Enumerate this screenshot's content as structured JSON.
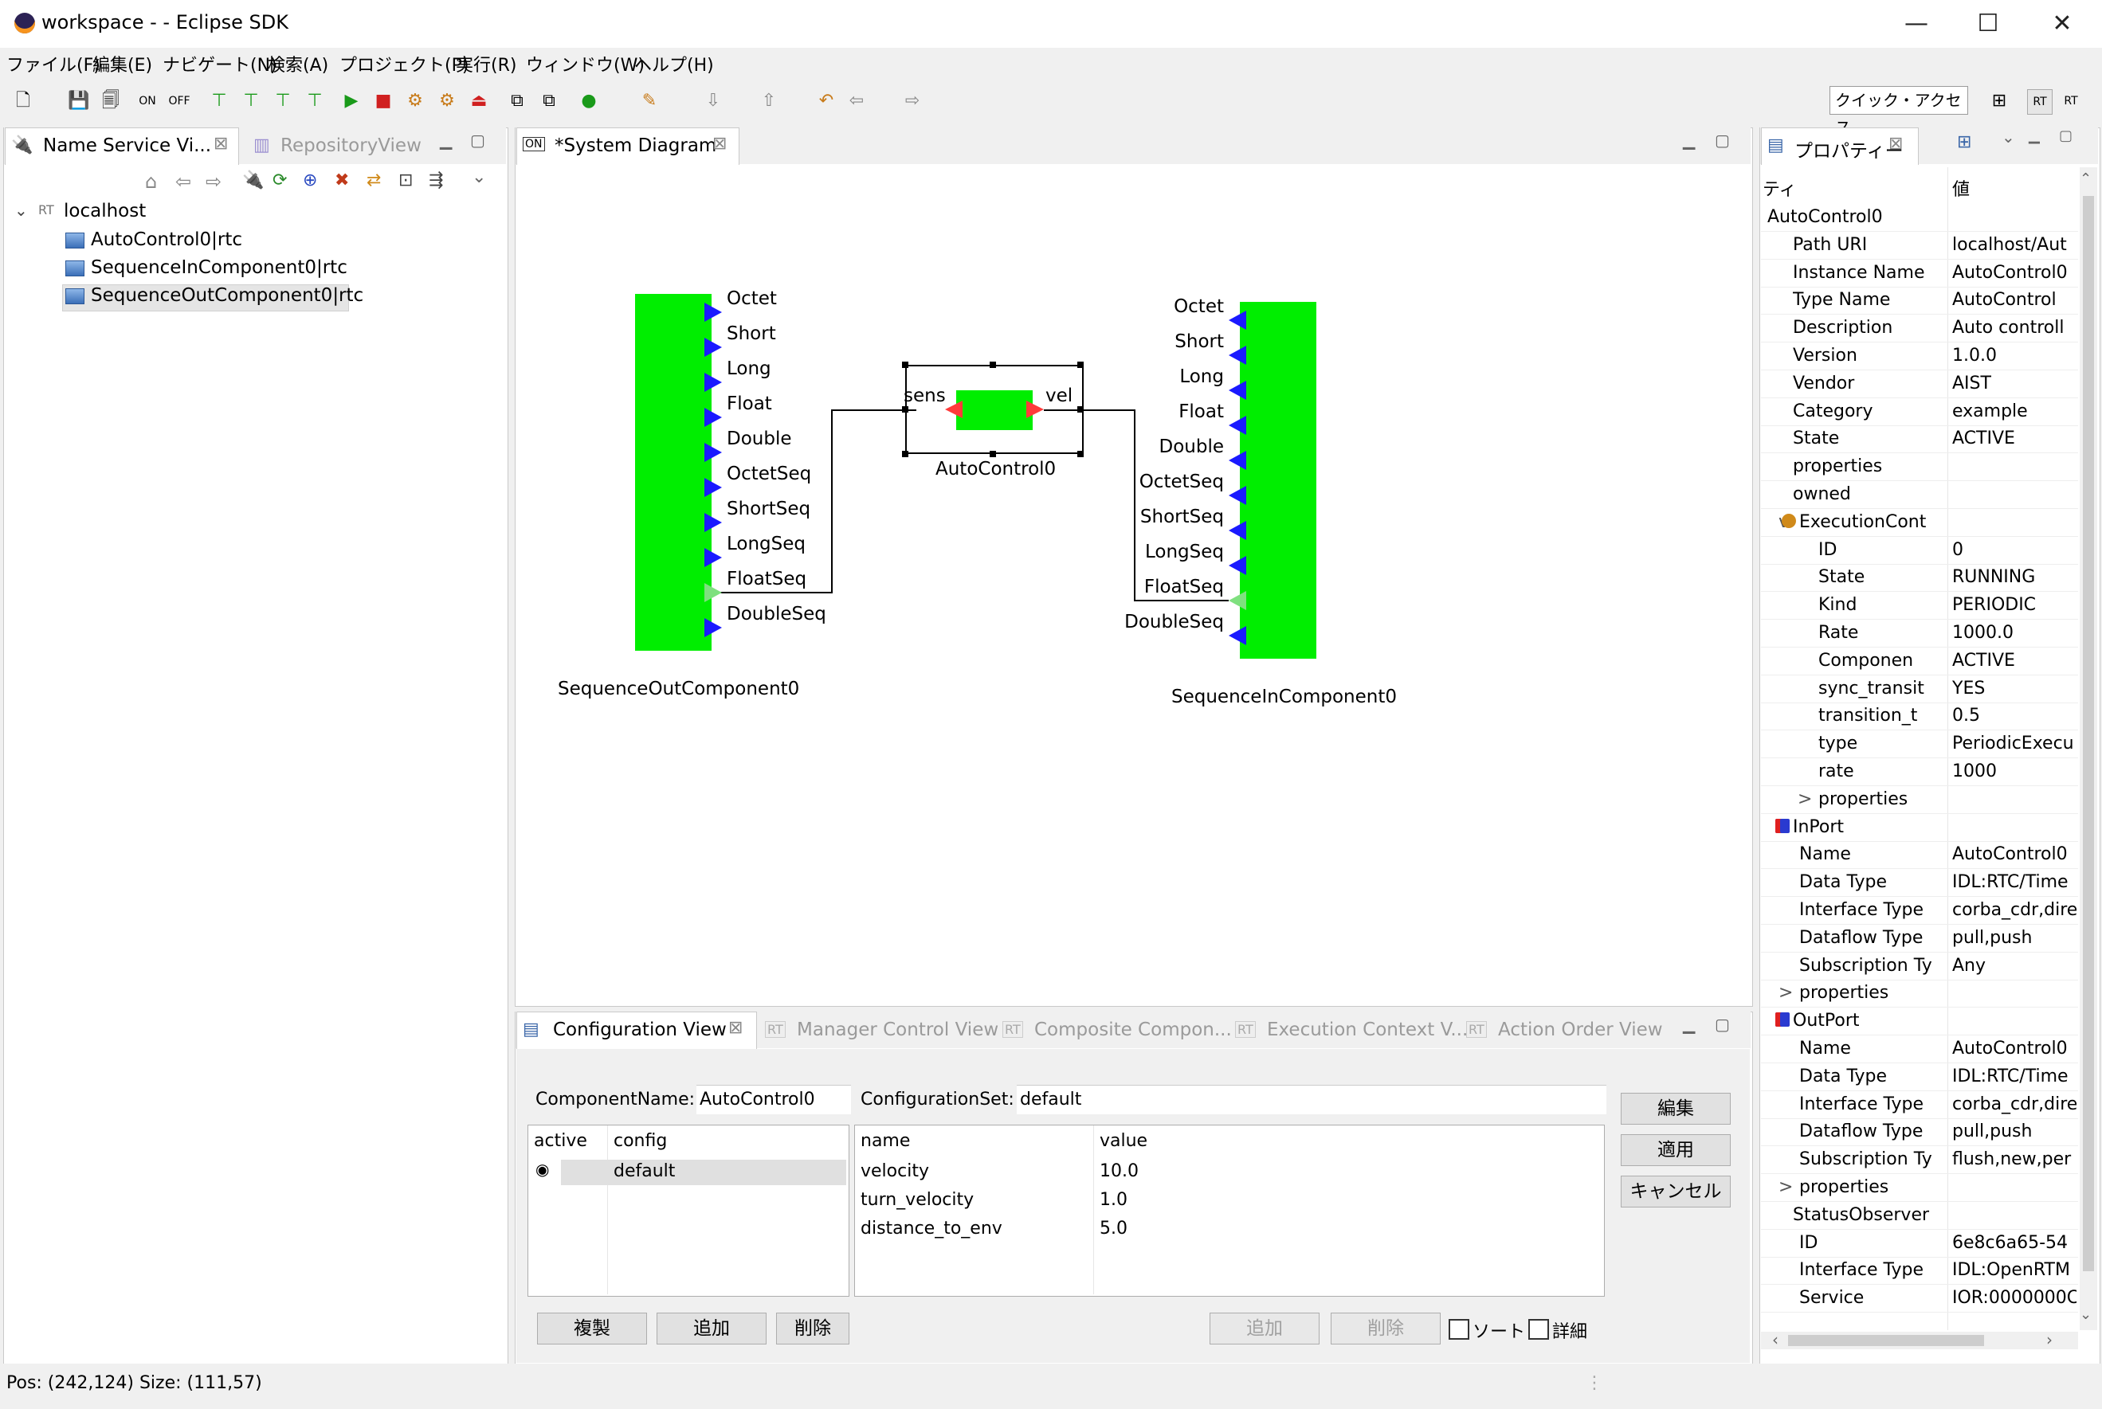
{
  "window": {
    "title": "workspace -  - Eclipse SDK",
    "minimize": "—",
    "maximize": "☐",
    "close": "✕"
  },
  "menu": [
    "ファイル(F)",
    "編集(E)",
    "ナビゲート(N)",
    "検索(A)",
    "プロジェクト(P)",
    "実行(R)",
    "ウィンドウ(W)",
    "ヘルプ(H)"
  ],
  "quick_access": "クイック・アクセス",
  "left_panel": {
    "tabs": [
      {
        "label": "Name Service Vi..."
      },
      {
        "label": "RepositoryView"
      }
    ],
    "tree": {
      "root": "localhost",
      "items": [
        "AutoControl0|rtc",
        "SequenceInComponent0|rtc",
        "SequenceOutComponent0|rtc"
      ]
    }
  },
  "editor": {
    "tab": "*System Diagram",
    "out_component": {
      "name": "SequenceOutComponent0",
      "ports": [
        "Octet",
        "Short",
        "Long",
        "Float",
        "Double",
        "OctetSeq",
        "ShortSeq",
        "LongSeq",
        "FloatSeq",
        "DoubleSeq"
      ]
    },
    "in_component": {
      "name": "SequenceInComponent0",
      "ports": [
        "Octet",
        "Short",
        "Long",
        "Float",
        "Double",
        "OctetSeq",
        "ShortSeq",
        "LongSeq",
        "FloatSeq",
        "DoubleSeq"
      ]
    },
    "auto_component": {
      "name": "AutoControl0",
      "in_port": "sens",
      "out_port": "vel"
    }
  },
  "bottom_panel": {
    "tabs": [
      "Configuration View",
      "Manager Control View",
      "Composite Compon...",
      "Execution Context V...",
      "Action Order View"
    ],
    "component_name_label": "ComponentName:",
    "component_name": "AutoControl0",
    "configuration_set_label": "ConfigurationSet:",
    "configuration_set": "default",
    "set_table": {
      "headers": [
        "active",
        "config"
      ],
      "rows": [
        {
          "active": "◉",
          "config": "default"
        }
      ]
    },
    "param_table": {
      "headers": [
        "name",
        "value"
      ],
      "rows": [
        {
          "name": "velocity",
          "value": "10.0"
        },
        {
          "name": "turn_velocity",
          "value": "1.0"
        },
        {
          "name": "distance_to_env",
          "value": "5.0"
        }
      ]
    },
    "buttons": {
      "edit": "編集",
      "apply": "適用",
      "cancel": "キャンセル",
      "copy": "複製",
      "add": "追加",
      "delete": "削除",
      "add2": "追加",
      "delete2": "削除",
      "sort": "ソート",
      "detail": "詳細"
    }
  },
  "properties": {
    "tab": "プロパティー",
    "headers": [
      "ティ",
      "値"
    ],
    "rows": [
      {
        "indent": 0,
        "key": "AutoControl0",
        "value": ""
      },
      {
        "indent": 1,
        "key": "Path URI",
        "value": "localhost/Aut"
      },
      {
        "indent": 1,
        "key": "Instance Name",
        "value": "AutoControl0"
      },
      {
        "indent": 1,
        "key": "Type Name",
        "value": "AutoControl"
      },
      {
        "indent": 1,
        "key": "Description",
        "value": "Auto controll"
      },
      {
        "indent": 1,
        "key": "Version",
        "value": "1.0.0"
      },
      {
        "indent": 1,
        "key": "Vendor",
        "value": "AIST"
      },
      {
        "indent": 1,
        "key": "Category",
        "value": "example"
      },
      {
        "indent": 1,
        "key": "State",
        "value": "ACTIVE"
      },
      {
        "indent": 1,
        "key": "properties",
        "value": ""
      },
      {
        "indent": 1,
        "key": "owned",
        "value": ""
      },
      {
        "indent": 2,
        "key": "ExecutionCont",
        "value": "",
        "expand": "v",
        "icon": "gear"
      },
      {
        "indent": 3,
        "key": "ID",
        "value": "0"
      },
      {
        "indent": 3,
        "key": "State",
        "value": "RUNNING"
      },
      {
        "indent": 3,
        "key": "Kind",
        "value": "PERIODIC"
      },
      {
        "indent": 3,
        "key": "Rate",
        "value": "1000.0"
      },
      {
        "indent": 3,
        "key": "Componen",
        "value": "ACTIVE"
      },
      {
        "indent": 3,
        "key": "sync_transit",
        "value": "YES"
      },
      {
        "indent": 3,
        "key": "transition_t",
        "value": "0.5"
      },
      {
        "indent": 3,
        "key": "type",
        "value": "PeriodicExecu"
      },
      {
        "indent": 3,
        "key": "rate",
        "value": "1000"
      },
      {
        "indent": 3,
        "key": "properties",
        "value": "",
        "expand": ">"
      },
      {
        "indent": 1,
        "key": "InPort",
        "value": "",
        "icon": "in"
      },
      {
        "indent": 2,
        "key": "Name",
        "value": "AutoControl0"
      },
      {
        "indent": 2,
        "key": "Data Type",
        "value": "IDL:RTC/Time"
      },
      {
        "indent": 2,
        "key": "Interface Type",
        "value": "corba_cdr,dire"
      },
      {
        "indent": 2,
        "key": "Dataflow Type",
        "value": "pull,push"
      },
      {
        "indent": 2,
        "key": "Subscription Ty",
        "value": "Any"
      },
      {
        "indent": 2,
        "key": "properties",
        "value": "",
        "expand": ">"
      },
      {
        "indent": 1,
        "key": "OutPort",
        "value": "",
        "icon": "out"
      },
      {
        "indent": 2,
        "key": "Name",
        "value": "AutoControl0"
      },
      {
        "indent": 2,
        "key": "Data Type",
        "value": "IDL:RTC/Time"
      },
      {
        "indent": 2,
        "key": "Interface Type",
        "value": "corba_cdr,dire"
      },
      {
        "indent": 2,
        "key": "Dataflow Type",
        "value": "pull,push"
      },
      {
        "indent": 2,
        "key": "Subscription Ty",
        "value": "flush,new,per"
      },
      {
        "indent": 2,
        "key": "properties",
        "value": "",
        "expand": ">"
      },
      {
        "indent": 1,
        "key": "StatusObserver",
        "value": ""
      },
      {
        "indent": 2,
        "key": "ID",
        "value": "6e8c6a65-54"
      },
      {
        "indent": 2,
        "key": "Interface Type",
        "value": "IDL:OpenRTM"
      },
      {
        "indent": 2,
        "key": "Service",
        "value": "IOR:0000000C"
      }
    ]
  },
  "status_bar": {
    "text": "Pos: (242,124) Size: (111,57)"
  },
  "colors": {
    "component_fill": "#00ee00",
    "port": "#1a1aff",
    "auto_port": "#ff3b3b"
  }
}
